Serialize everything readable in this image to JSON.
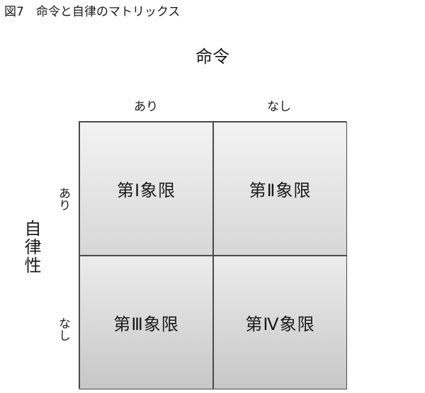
{
  "figure": {
    "title": "図7　命令と自律のマトリックス"
  },
  "columns": {
    "axis_title": "命令",
    "headers": [
      "あり",
      "なし"
    ]
  },
  "rows": {
    "axis_title": "自律性",
    "headers": [
      "あり",
      "なし"
    ]
  },
  "quadrants": [
    {
      "label": "第Ⅰ象限"
    },
    {
      "label": "第Ⅱ象限"
    },
    {
      "label": "第Ⅲ象限"
    },
    {
      "label": "第Ⅳ象限"
    }
  ]
}
